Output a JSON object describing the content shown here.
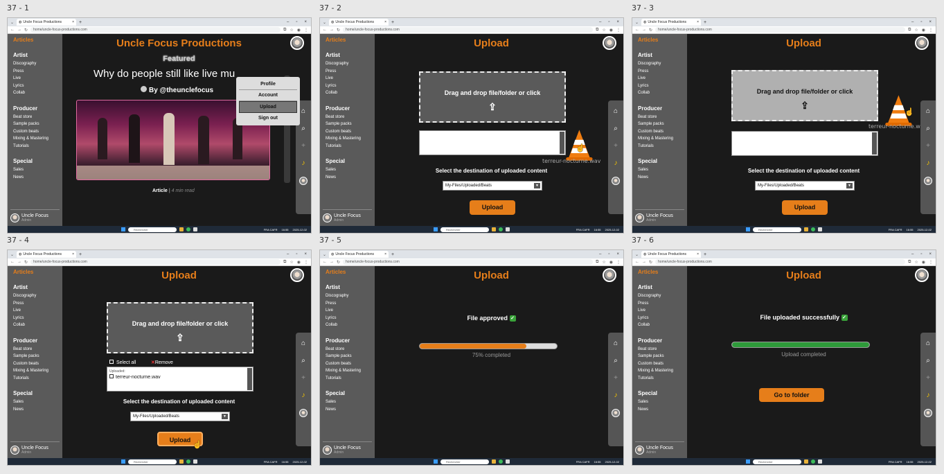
{
  "frames": [
    {
      "label": "37 - 1"
    },
    {
      "label": "37 - 2"
    },
    {
      "label": "37 - 3"
    },
    {
      "label": "37 - 4"
    },
    {
      "label": "37 - 5"
    },
    {
      "label": "37 - 6"
    }
  ],
  "browser": {
    "tab_title": "Uncle Focus Productions",
    "url": "home/uncle-focus-productions.com"
  },
  "sidebar": {
    "articles": "Articles",
    "sections": [
      {
        "heading": "Artist",
        "items": [
          "Discography",
          "Press",
          "Live",
          "Lyrics",
          "Collab"
        ]
      },
      {
        "heading": "Producer",
        "items": [
          "Beat store",
          "Sample packs",
          "Custom beats",
          "Mixing & Mastering",
          "Tutorials"
        ]
      },
      {
        "heading": "Special",
        "items": [
          "Sales",
          "News"
        ]
      }
    ],
    "user_name": "Uncle Focus",
    "user_role": "Admin"
  },
  "home": {
    "title": "Uncle Focus Productions",
    "featured": "Featured",
    "headline": "Why do people still like live mu",
    "byline": "By @theunclefocus",
    "article_label": "Article",
    "read_time": "4 min read"
  },
  "menu": {
    "items": [
      "Profile",
      "Account",
      "Upload",
      "Sign out"
    ]
  },
  "upload": {
    "title": "Upload",
    "dropzone_text": "Drag and drop file/folder or click",
    "dest_label": "Select the destination of uploaded content",
    "dest_value": "My-Files/Uploaded/Beats",
    "button": "Upload",
    "dragged_file": "terreur-nocturne.wav",
    "select_all": "Select all",
    "remove": "Remove",
    "uploaded_label": "Uploaded:",
    "file_item": "terreur-nocturne.wav"
  },
  "progress": {
    "approved": "File approved",
    "percent_text": "75% completed",
    "fraction": 0.78,
    "success": "File uploaded successfully",
    "complete_text": "Upload completed",
    "go_folder": "Go to folder"
  },
  "taskbar": {
    "search": "Rechercher",
    "lang": "FRA CAFR",
    "time": "16:55",
    "date": "2025-12-02"
  },
  "colors": {
    "accent": "#e67e1a",
    "success": "#2e9a3a",
    "sidebar": "#5a5a5a"
  }
}
